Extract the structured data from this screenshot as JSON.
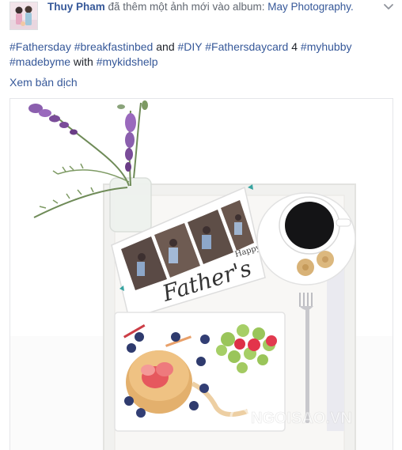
{
  "post": {
    "author_name": "Thuy Pham",
    "action_text": "đã thêm một ảnh mới vào album:",
    "album_name": "May Photography.",
    "caption": {
      "line1": [
        {
          "text": "#Fathersday",
          "type": "tag"
        },
        {
          "text": " ",
          "type": "text"
        },
        {
          "text": "#breakfastinbed",
          "type": "tag"
        },
        {
          "text": " and ",
          "type": "text"
        },
        {
          "text": "#DIY",
          "type": "tag"
        },
        {
          "text": " ",
          "type": "text"
        },
        {
          "text": "#Fathersdaycard",
          "type": "tag"
        },
        {
          "text": " 4 ",
          "type": "text"
        },
        {
          "text": "#myhubby",
          "type": "tag"
        }
      ],
      "line2": [
        {
          "text": "#madebyme",
          "type": "tag"
        },
        {
          "text": " with ",
          "type": "text"
        },
        {
          "text": "#mykidshelp",
          "type": "tag"
        }
      ]
    },
    "translate_link": "Xem bản dịch",
    "photo": {
      "card_text": "Father's",
      "card_small_text": "Happy",
      "watermark": "NGOISAO.VN"
    },
    "icons": [
      "avatar",
      "chevron-down-icon"
    ]
  },
  "colors": {
    "link": "#365899",
    "text": "#1d2129",
    "muted": "#616770"
  }
}
